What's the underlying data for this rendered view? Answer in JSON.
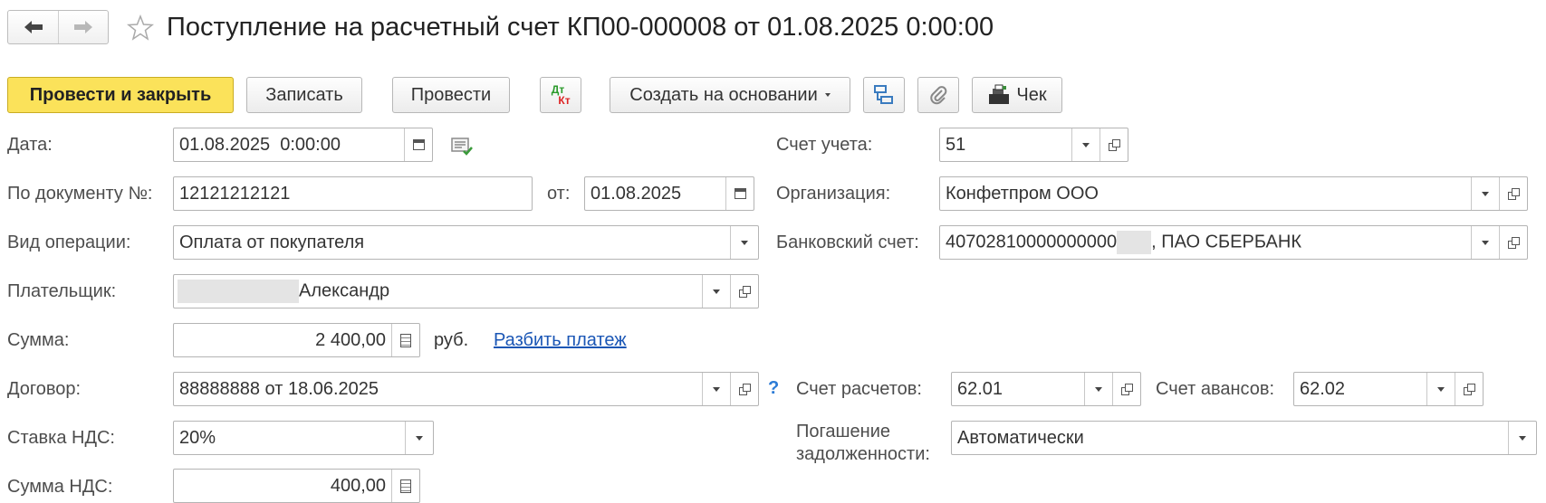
{
  "nav": {
    "back_icon": "arrow-left-icon",
    "forward_icon": "arrow-right-icon",
    "favorite_icon": "star-icon"
  },
  "title": "Поступление на расчетный счет КП00-000008 от 01.08.2025 0:00:00",
  "toolbar": {
    "post_close": "Провести и закрыть",
    "save": "Записать",
    "post": "Провести",
    "dtkt_top": "Дт",
    "dtkt_bottom": "Кт",
    "create_based": "Создать на основании",
    "check": "Чек"
  },
  "form": {
    "date_label": "Дата:",
    "date_value": "01.08.2025  0:00:00",
    "docnum_label": "По документу №:",
    "docnum_value": "12121212121",
    "from_label": "от:",
    "from_value": "01.08.2025",
    "optype_label": "Вид операции:",
    "optype_value": "Оплата от покупателя",
    "payer_label": "Плательщик:",
    "payer_value": "Александр",
    "sum_label": "Сумма:",
    "sum_value": "2 400,00",
    "currency": "руб.",
    "split_link": "Разбить платеж",
    "contract_label": "Договор:",
    "contract_value": "88888888 от 18.06.2025",
    "help": "?",
    "vat_rate_label": "Ставка НДС:",
    "vat_rate_value": "20%",
    "vat_sum_label": "Сумма НДС:",
    "vat_sum_value": "400,00",
    "account_label": "Счет учета:",
    "account_value": "51",
    "org_label": "Организация:",
    "org_value": "Конфетпром ООО",
    "bank_label": "Банковский счет:",
    "bank_value_a": "40702810000000000",
    "bank_value_b": ", ПАО СБЕРБАНК",
    "settle_label": "Счет расчетов:",
    "settle_value": "62.01",
    "advance_label": "Счет авансов:",
    "advance_value": "62.02",
    "debt_label_1": "Погашение",
    "debt_label_2": "задолженности:",
    "debt_value": "Автоматически"
  }
}
